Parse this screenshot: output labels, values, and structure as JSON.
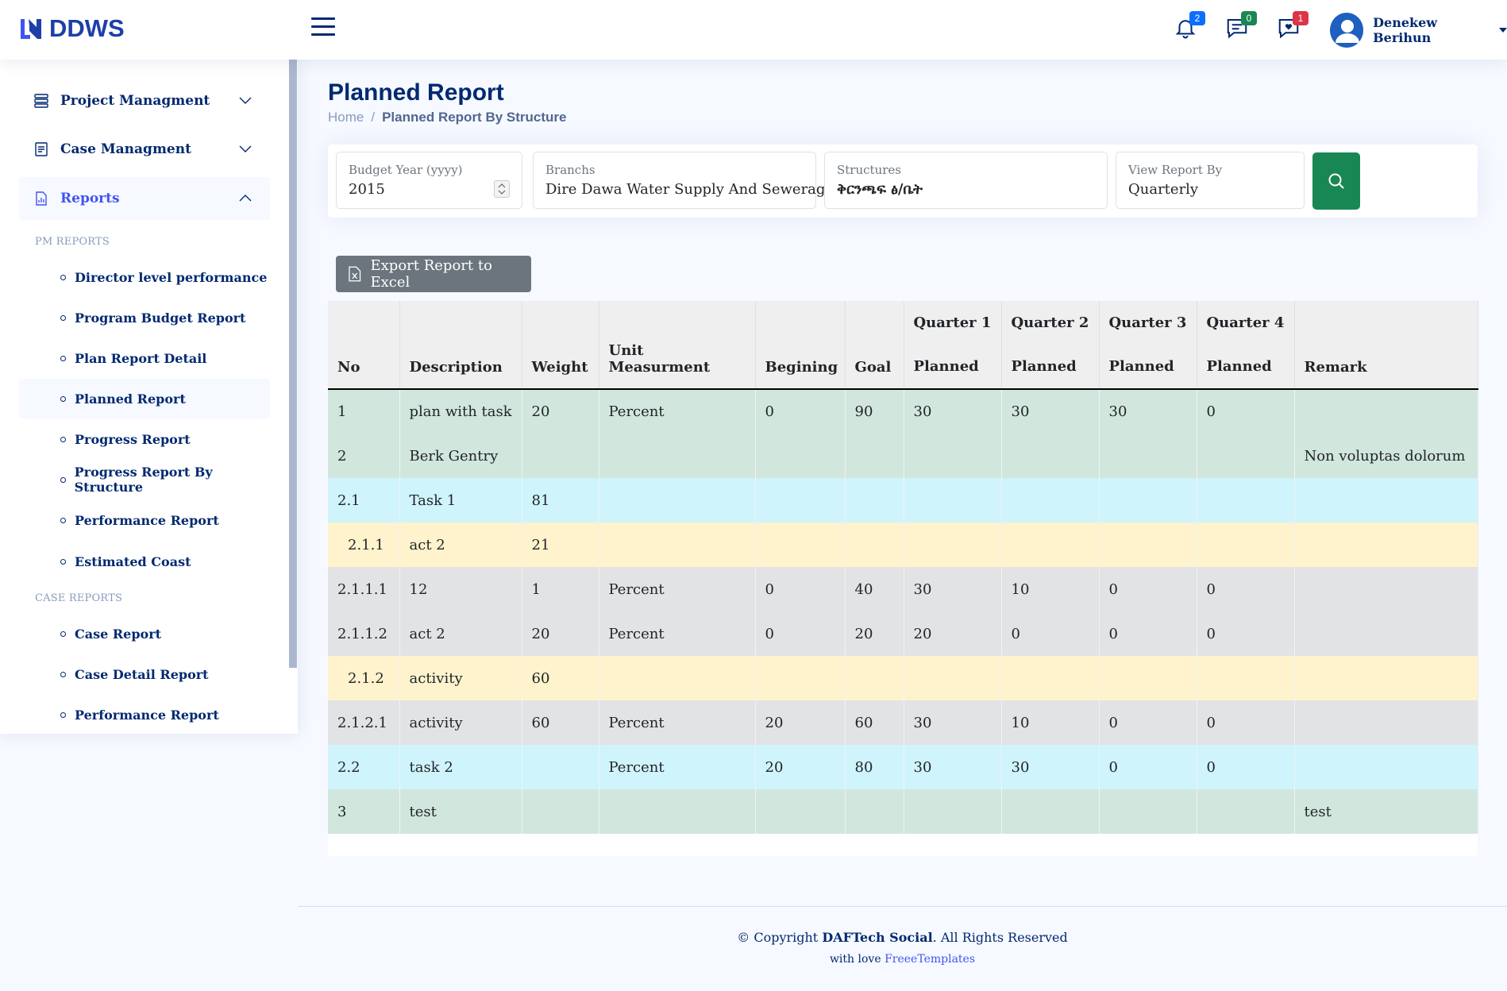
{
  "app": {
    "brand": "DDWS"
  },
  "header": {
    "notifications_count": "2",
    "messages_count": "0",
    "chat_count": "1",
    "user_name": "Denekew Berihun",
    "colors": {
      "notif_badge": "#0d6efd",
      "msg_badge": "#198754",
      "chat_badge": "#dc3545"
    }
  },
  "sidebar": {
    "menu": [
      {
        "label": "Project Managment",
        "icon": "layers-icon"
      },
      {
        "label": "Case Managment",
        "icon": "document-icon"
      },
      {
        "label": "Reports",
        "icon": "report-icon"
      }
    ],
    "pm_heading": "PM REPORTS",
    "pm_reports": [
      "Director level performance",
      "Program Budget Report",
      "Plan Report Detail",
      "Planned Report",
      "Progress Report",
      "Progress Report By Structure",
      "Performance Report",
      "Estimated Coast"
    ],
    "case_heading": "CASE REPORTS",
    "case_reports": [
      "Case Report",
      "Case Detail Report",
      "Performance Report"
    ]
  },
  "page": {
    "title": "Planned Report",
    "breadcrumb": {
      "home": "Home",
      "separator": "/",
      "current": "Planned Report By Structure"
    }
  },
  "filters": {
    "budget_year": {
      "label": "Budget Year (yyyy)",
      "value": "2015"
    },
    "branch": {
      "label": "Branchs",
      "value": "Dire Dawa Water Supply And Sewerage"
    },
    "structure": {
      "label": "Structures",
      "value": "ቅርንጫፍ ፅ/ቤት"
    },
    "view_by": {
      "label": "View Report By",
      "value": "Quarterly"
    }
  },
  "export_label": "Export Report to Excel",
  "table": {
    "headers": {
      "no": "No",
      "description": "Description",
      "weight": "Weight",
      "unit": "Unit Measurment",
      "begining": "Begining",
      "goal": "Goal",
      "q1": "Quarter 1",
      "q2": "Quarter 2",
      "q3": "Quarter 3",
      "q4": "Quarter 4",
      "planned": "Planned",
      "remark": "Remark"
    },
    "rows": [
      {
        "no": "1",
        "description": "plan with task",
        "weight": "20",
        "unit": "Percent",
        "begining": "0",
        "goal": "90",
        "q1": "30",
        "q2": "30",
        "q3": "30",
        "q4": "0",
        "remark": "",
        "level": "green"
      },
      {
        "no": "2",
        "description": "Berk Gentry",
        "weight": "",
        "unit": "",
        "begining": "",
        "goal": "",
        "q1": "",
        "q2": "",
        "q3": "",
        "q4": "",
        "remark": "Non voluptas dolorum",
        "level": "green"
      },
      {
        "no": "2.1",
        "description": "Task 1",
        "weight": "81",
        "unit": "",
        "begining": "",
        "goal": "",
        "q1": "",
        "q2": "",
        "q3": "",
        "q4": "",
        "remark": "",
        "level": "cyan"
      },
      {
        "no": "2.1.1",
        "description": "act 2",
        "weight": "21",
        "unit": "",
        "begining": "",
        "goal": "",
        "q1": "",
        "q2": "",
        "q3": "",
        "q4": "",
        "remark": "",
        "level": "yellow"
      },
      {
        "no": "2.1.1.1",
        "description": "12",
        "weight": "1",
        "unit": "Percent",
        "begining": "0",
        "goal": "40",
        "q1": "30",
        "q2": "10",
        "q3": "0",
        "q4": "0",
        "remark": "",
        "level": "grey"
      },
      {
        "no": "2.1.1.2",
        "description": "act 2",
        "weight": "20",
        "unit": "Percent",
        "begining": "0",
        "goal": "20",
        "q1": "20",
        "q2": "0",
        "q3": "0",
        "q4": "0",
        "remark": "",
        "level": "grey"
      },
      {
        "no": "2.1.2",
        "description": "activity",
        "weight": "60",
        "unit": "",
        "begining": "",
        "goal": "",
        "q1": "",
        "q2": "",
        "q3": "",
        "q4": "",
        "remark": "",
        "level": "yellow"
      },
      {
        "no": "2.1.2.1",
        "description": "activity",
        "weight": "60",
        "unit": "Percent",
        "begining": "20",
        "goal": "60",
        "q1": "30",
        "q2": "10",
        "q3": "0",
        "q4": "0",
        "remark": "",
        "level": "grey"
      },
      {
        "no": "2.2",
        "description": "task 2",
        "weight": "",
        "unit": "Percent",
        "begining": "20",
        "goal": "80",
        "q1": "30",
        "q2": "30",
        "q3": "0",
        "q4": "0",
        "remark": "",
        "level": "cyan"
      },
      {
        "no": "3",
        "description": "test",
        "weight": "",
        "unit": "",
        "begining": "",
        "goal": "",
        "q1": "",
        "q2": "",
        "q3": "",
        "q4": "",
        "remark": "test",
        "level": "green"
      }
    ]
  },
  "footer": {
    "copyright_prefix": "© Copyright",
    "company": "DAFTech Social",
    "rights": ". All Rights Reserved",
    "credits_prefix": "with love",
    "credits_link": "FreeeTemplates"
  }
}
